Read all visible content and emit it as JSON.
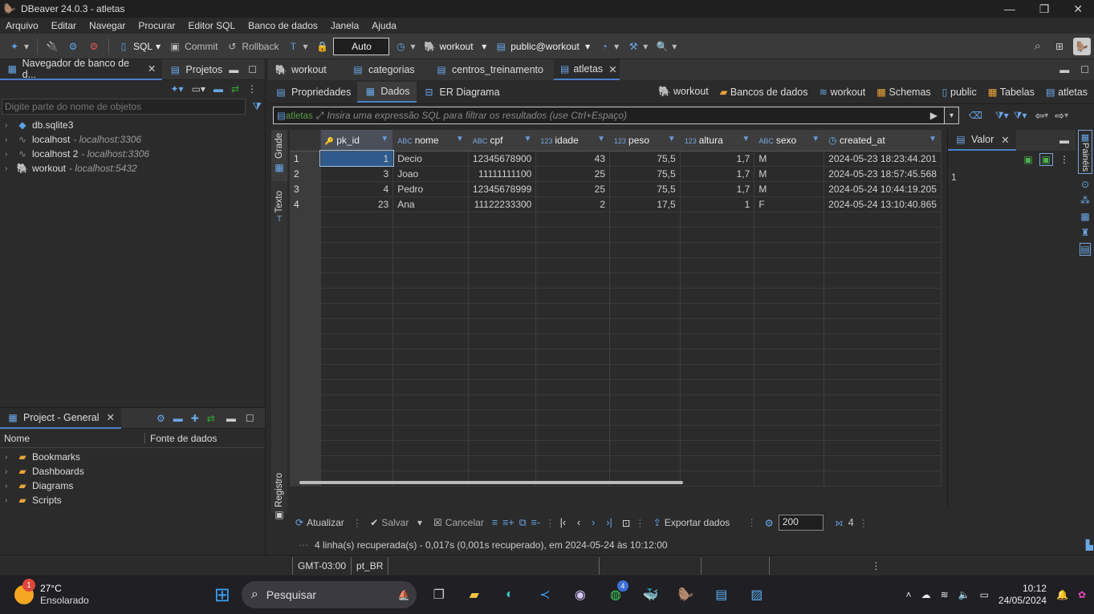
{
  "window": {
    "title": "DBeaver 24.0.3 - atletas"
  },
  "menu": [
    "Arquivo",
    "Editar",
    "Navegar",
    "Procurar",
    "Editor SQL",
    "Banco de dados",
    "Janela",
    "Ajuda"
  ],
  "toolbar": {
    "sql": "SQL",
    "commit": "Commit",
    "rollback": "Rollback",
    "auto": "Auto",
    "connection": "workout",
    "schema": "public@workout"
  },
  "navigator": {
    "title": "Navegador de banco de d...",
    "projects_tab": "Projetos",
    "filter_placeholder": "Digite parte do nome de objetos",
    "items": [
      {
        "name": "db.sqlite3",
        "sub": ""
      },
      {
        "name": "localhost",
        "sub": "- localhost:3306"
      },
      {
        "name": "localhost 2",
        "sub": "- localhost:3306"
      },
      {
        "name": "workout",
        "sub": "- localhost:5432"
      }
    ]
  },
  "project": {
    "title": "Project - General",
    "col_name": "Nome",
    "col_source": "Fonte de dados",
    "items": [
      "Bookmarks",
      "Dashboards",
      "Diagrams",
      "Scripts"
    ]
  },
  "editor_tabs": [
    "workout",
    "categorias",
    "centros_treinamento",
    "atletas"
  ],
  "sub_tabs": {
    "properties": "Propriedades",
    "data": "Dados",
    "er": "ER Diagrama"
  },
  "breadcrumbs": [
    "workout",
    "Bancos de dados",
    "workout",
    "Schemas",
    "public",
    "Tabelas",
    "atletas"
  ],
  "filter": {
    "table_label": "atletas",
    "placeholder": "Insira uma expressão SQL para filtrar os resultados (use Ctrl+Espaço)"
  },
  "side_tabs": {
    "grid": "Grade",
    "text": "Texto",
    "log": "Registro"
  },
  "columns": [
    {
      "type": "",
      "name": "pk_id"
    },
    {
      "type": "ABC",
      "name": "nome"
    },
    {
      "type": "ABC",
      "name": "cpf"
    },
    {
      "type": "123",
      "name": "idade"
    },
    {
      "type": "123",
      "name": "peso"
    },
    {
      "type": "123",
      "name": "altura"
    },
    {
      "type": "ABC",
      "name": "sexo"
    },
    {
      "type": "",
      "name": "created_at"
    }
  ],
  "rows": [
    [
      "1",
      "1",
      "Decio",
      "12345678900",
      "43",
      "75,5",
      "1,7",
      "M",
      "2024-05-23 18:23:44.201"
    ],
    [
      "2",
      "3",
      "Joao",
      "11111111100",
      "25",
      "75,5",
      "1,7",
      "M",
      "2024-05-23 18:57:45.568"
    ],
    [
      "3",
      "4",
      "Pedro",
      "12345678999",
      "25",
      "75,5",
      "1,7",
      "M",
      "2024-05-24 10:44:19.205"
    ],
    [
      "4",
      "23",
      "Ana",
      "11122233300",
      "2",
      "17,5",
      "1",
      "F",
      "2024-05-24 13:10:40.865"
    ]
  ],
  "value_panel": {
    "title": "Valor",
    "value": "1",
    "side_label": "Painéis"
  },
  "bottom_toolbar": {
    "refresh": "Atualizar",
    "save": "Salvar",
    "cancel": "Cancelar",
    "export": "Exportar dados",
    "fetch_size": "200",
    "row_count": "4"
  },
  "status_message": "4 linha(s) recuperada(s) - 0,017s (0,001s recuperado), em 2024-05-24 às 10:12:00",
  "statusbar": {
    "timezone": "GMT-03:00",
    "locale": "pt_BR"
  },
  "taskbar": {
    "weather_temp": "27°C",
    "weather_desc": "Ensolarado",
    "weather_badge": "1",
    "search": "Pesquisar",
    "time": "10:12",
    "date": "24/05/2024",
    "whatsapp_badge": "4"
  }
}
